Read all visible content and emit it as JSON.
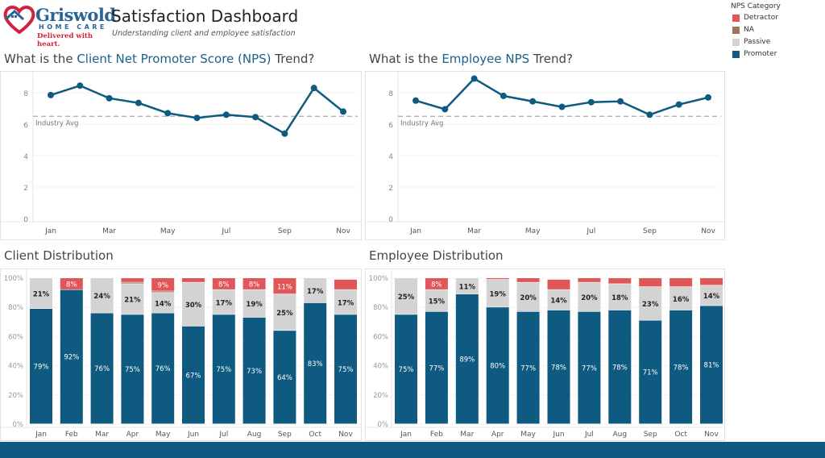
{
  "header": {
    "logo": {
      "brand": "Griswold",
      "tagline": "HOME CARE",
      "slogan": "Delivered with heart."
    },
    "title": "Satisfaction Dashboard",
    "subtitle": "Understanding client and employee satisfaction"
  },
  "legend": {
    "title": "NPS Category",
    "items": [
      {
        "label": "Detractor",
        "color": "#e15759"
      },
      {
        "label": "NA",
        "color": "#9c755f"
      },
      {
        "label": "Passive",
        "color": "#d3d3d3"
      },
      {
        "label": "Promoter",
        "color": "#0e5a80"
      }
    ]
  },
  "titles": {
    "client_trend": {
      "pre": "What is the ",
      "hl": "Client Net Promoter Score (NPS)",
      "post": " Trend?"
    },
    "employee_trend": {
      "pre": "What is the ",
      "hl": "Employee NPS",
      "post": " Trend?"
    },
    "client_dist": "Client Distribution",
    "employee_dist": "Employee Distribution"
  },
  "chart_data": [
    {
      "id": "client_trend",
      "type": "line",
      "x": [
        "Jan",
        "Feb",
        "Mar",
        "Apr",
        "May",
        "Jun",
        "Jul",
        "Aug",
        "Sep",
        "Oct",
        "Nov"
      ],
      "x_tick_labels": [
        "Jan",
        "Mar",
        "May",
        "Jul",
        "Sep",
        "Nov"
      ],
      "y_ticks": [
        0,
        2,
        4,
        6,
        8
      ],
      "values": [
        7.85,
        8.45,
        7.65,
        7.35,
        6.7,
        6.4,
        6.6,
        6.45,
        5.4,
        8.3,
        6.8
      ],
      "reference_line": {
        "label": "Industry Avg",
        "value": 6.5
      },
      "color": "#0e5a80",
      "grid": true
    },
    {
      "id": "employee_trend",
      "type": "line",
      "x": [
        "Jan",
        "Feb",
        "Mar",
        "Apr",
        "May",
        "Jun",
        "Jul",
        "Aug",
        "Sep",
        "Oct",
        "Nov"
      ],
      "x_tick_labels": [
        "Jan",
        "Mar",
        "May",
        "Jul",
        "Sep",
        "Nov"
      ],
      "y_ticks": [
        0,
        2,
        4,
        6,
        8
      ],
      "values": [
        7.5,
        6.95,
        8.9,
        7.8,
        7.45,
        7.1,
        7.4,
        7.45,
        6.6,
        7.25,
        7.7
      ],
      "reference_line": {
        "label": "Industry Avg",
        "value": 6.5
      },
      "color": "#0e5a80",
      "grid": true
    },
    {
      "id": "client_dist",
      "type": "bar",
      "stacked": "100%",
      "categories": [
        "Jan",
        "Feb",
        "Mar",
        "Apr",
        "May",
        "Jun",
        "Jul",
        "Aug",
        "Sep",
        "Oct",
        "Nov"
      ],
      "y_ticks": [
        "0%",
        "20%",
        "40%",
        "60%",
        "80%",
        "100%"
      ],
      "series": [
        {
          "name": "Promoter",
          "values": [
            79,
            92,
            76,
            75,
            76,
            67,
            75,
            73,
            64,
            83,
            75
          ]
        },
        {
          "name": "Passive",
          "values": [
            21,
            0,
            24,
            21,
            14,
            30,
            17,
            19,
            25,
            17,
            17
          ]
        },
        {
          "name": "NA",
          "values": [
            0,
            0,
            0,
            1,
            1,
            0,
            0,
            0,
            0,
            0,
            0
          ]
        },
        {
          "name": "Detractor",
          "values": [
            0,
            8,
            0,
            3,
            9,
            3,
            8,
            8,
            11,
            0,
            7
          ]
        }
      ]
    },
    {
      "id": "employee_dist",
      "type": "bar",
      "stacked": "100%",
      "categories": [
        "Jan",
        "Feb",
        "Mar",
        "Apr",
        "May",
        "Jun",
        "Jul",
        "Aug",
        "Sep",
        "Oct",
        "Nov"
      ],
      "y_ticks": [
        "0%",
        "20%",
        "40%",
        "60%",
        "80%",
        "100%"
      ],
      "series": [
        {
          "name": "Promoter",
          "values": [
            75,
            77,
            89,
            80,
            77,
            78,
            77,
            78,
            71,
            78,
            81
          ]
        },
        {
          "name": "Passive",
          "values": [
            25,
            15,
            11,
            19,
            20,
            14,
            20,
            18,
            23,
            16,
            14
          ]
        },
        {
          "name": "NA",
          "values": [
            0,
            0,
            0,
            0,
            0,
            0,
            0,
            0,
            0,
            0,
            0
          ]
        },
        {
          "name": "Detractor",
          "values": [
            0,
            8,
            0,
            1,
            3,
            7,
            3,
            4,
            6,
            6,
            5
          ]
        }
      ]
    }
  ]
}
